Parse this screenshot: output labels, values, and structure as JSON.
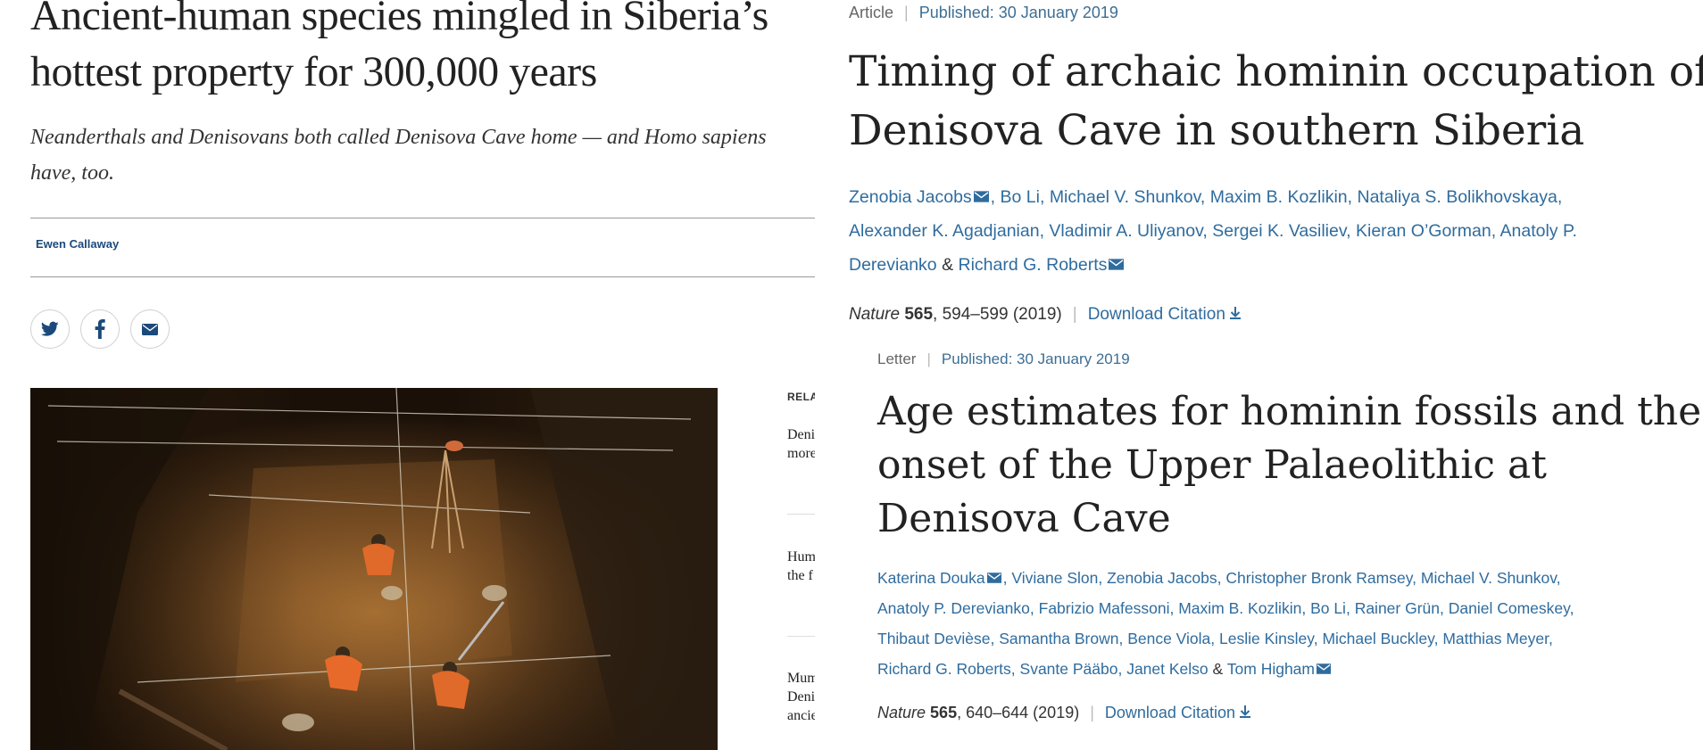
{
  "left_article": {
    "headline_line1": "Ancient-human species mingled in Siberia’s",
    "headline_line2": "hottest property for 300,000 years",
    "standfirst_line1": "Neanderthals and Denisovans both called Denisova Cave home — and Homo sapiens",
    "standfirst_line2": "have, too.",
    "author": "Ewen Callaway",
    "share": {
      "twitter_icon": "twitter-icon",
      "facebook_icon": "facebook-icon",
      "email_icon": "email-icon"
    },
    "related_label": "RELATED",
    "related_items": [
      {
        "line1": "Denisovan",
        "line2": "more"
      },
      {
        "line1": "Humans",
        "line2": "the f"
      },
      {
        "line1": "Mum",
        "line2": "Denis",
        "line3": "ancie"
      }
    ]
  },
  "article1": {
    "type": "Article",
    "published": "Published: 30 January 2019",
    "title_line1": "Timing of archaic hominin occupation of",
    "title_line2": "Denisova Cave in southern Siberia",
    "authors_line1": [
      "Zenobia Jacobs",
      "Bo Li",
      "Michael V. Shunkov",
      "Maxim B. Kozlikin",
      "Nataliya S. Bolikhovskaya"
    ],
    "authors_line2": [
      "Alexander K. Agadjanian",
      "Vladimir A. Uliyanov",
      "Sergei K. Vasiliev",
      "Kieran O’Gorman",
      "Anatoly P."
    ],
    "authors_line3_a": "Derevianko",
    "authors_line3_b": "Richard G. Roberts",
    "journal": "Nature",
    "volume": "565",
    "pages": ", 594–599 (2019)",
    "download": "Download Citation"
  },
  "article2": {
    "type": "Letter",
    "published": "Published: 30 January 2019",
    "title_line1": "Age estimates for hominin fossils and the",
    "title_line2": "onset of the Upper Palaeolithic at",
    "title_line3": "Denisova Cave",
    "authors_line1": [
      "Katerina Douka",
      "Viviane Slon",
      "Zenobia Jacobs",
      "Christopher Bronk Ramsey",
      "Michael V. Shunkov"
    ],
    "authors_line2": [
      "Anatoly P. Derevianko",
      "Fabrizio Mafessoni",
      "Maxim B. Kozlikin",
      "Bo Li",
      "Rainer Grün",
      "Daniel Comeskey"
    ],
    "authors_line3": [
      "Thibaut Devièse",
      "Samantha Brown",
      "Bence Viola",
      "Leslie Kinsley",
      "Michael Buckley",
      "Matthias Meyer"
    ],
    "authors_line4_list": [
      "Richard G. Roberts",
      "Svante Pääbo",
      "Janet Kelso"
    ],
    "authors_line4_last": "Tom Higham",
    "journal": "Nature",
    "volume": "565",
    "pages": ", 640–644 (2019)",
    "download": "Download Citation"
  },
  "colors": {
    "link": "#2f6c9e",
    "text": "#222222",
    "muted": "#666666"
  }
}
